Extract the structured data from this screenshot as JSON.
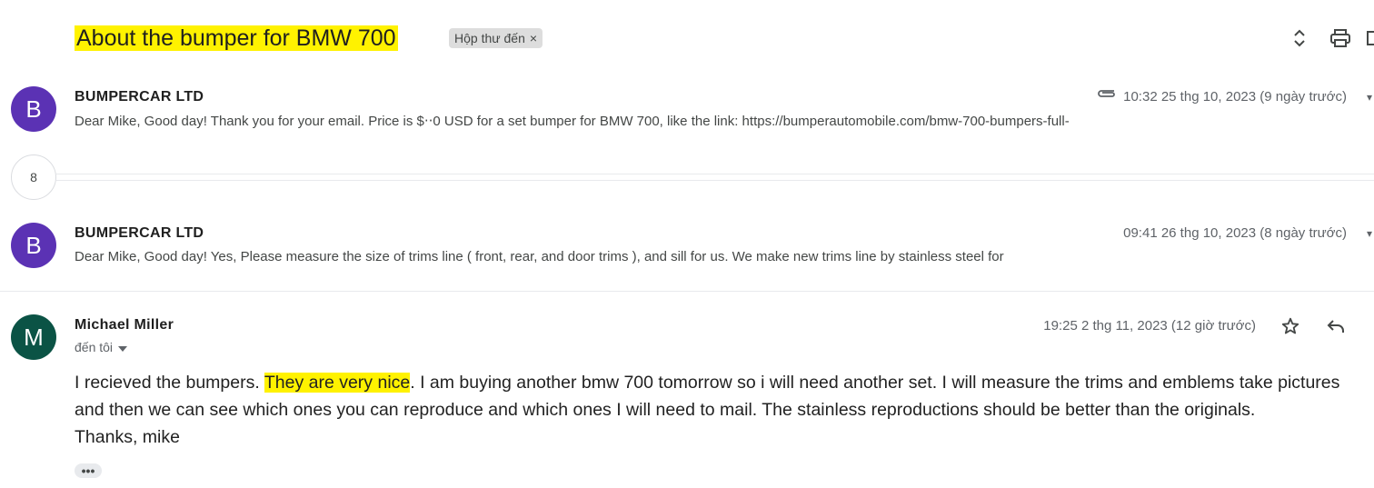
{
  "thread": {
    "subject": "About the bumper for BMW 700",
    "label": "Hộp thư đến",
    "label_remove": "×",
    "collapsed_count": "8"
  },
  "messages": [
    {
      "avatar_letter": "B",
      "avatar_color": "#5b32b4",
      "sender": "BUMPERCAR LTD",
      "date": "10:32 25 thg 10, 2023 (9 ngày trước)",
      "snippet": "Dear Mike, Good day! Thank you for your email. Price is $‧‧0 USD for a set bumper for BMW 700, like the link: https://bumperautomobile.com/bmw-700-bumpers-full-",
      "has_attachment": true
    },
    {
      "avatar_letter": "B",
      "avatar_color": "#5b32b4",
      "sender": "BUMPERCAR LTD",
      "date": "09:41 26 thg 10, 2023 (8 ngày trước)",
      "snippet": "Dear Mike, Good day! Yes, Please measure the size of trims line ( front, rear, and door trims ), and sill for us. We make new trims line by stainless steel for"
    },
    {
      "avatar_letter": "M",
      "avatar_color": "#0b5345",
      "sender": "Michael Miller",
      "date": "19:25 2 thg 11, 2023 (12 giờ trước)",
      "recipient": "đến tôi",
      "body": {
        "line1_a": "I recieved the bumpers. ",
        "line1_highlight": "They are very nice",
        "line1_b": ". I am buying another bmw 700 tomorrow so i will need another set. I will measure the trims and emblems take pictures",
        "line2": "and then we can see which ones you can reproduce and which ones I will need to mail. The stainless reproductions should be better than the originals.",
        "line3": "Thanks, mike"
      },
      "more": "•••"
    }
  ],
  "icons": {
    "expand": "expand-collapse-icon",
    "print": "print-icon",
    "attachment": "paperclip-icon",
    "star": "star-icon",
    "reply": "reply-icon",
    "dropdown": "caret-down-icon"
  },
  "colors": {
    "highlight": "#fff200",
    "chip_bg": "#dddddd"
  }
}
